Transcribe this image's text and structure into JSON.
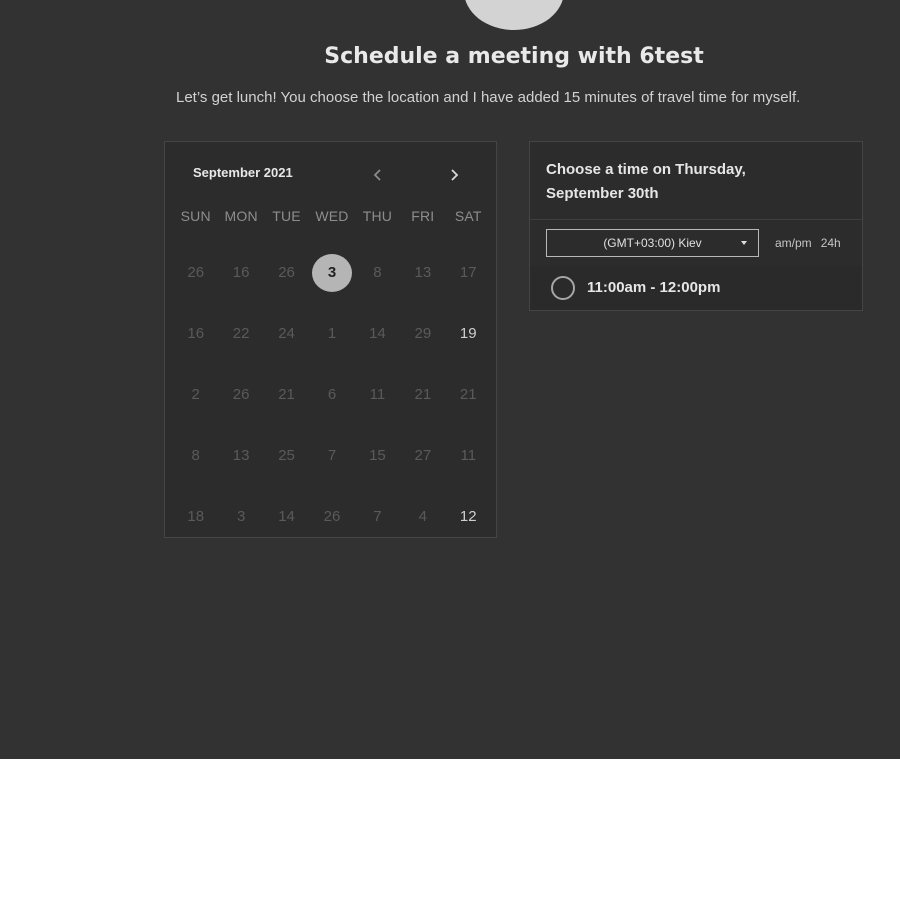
{
  "page": {
    "title": "Schedule a meeting with 6test",
    "description": "Let’s get lunch! You choose the location and I have added 15 minutes of travel time for myself."
  },
  "calendar": {
    "month_label": "September 2021",
    "prev_icon": "chevron-left-icon",
    "next_icon": "chevron-right-icon",
    "weekdays": [
      "SUN",
      "MON",
      "TUE",
      "WED",
      "THU",
      "FRI",
      "SAT"
    ],
    "days": [
      {
        "label": "26",
        "state": "disabled"
      },
      {
        "label": "16",
        "state": "disabled"
      },
      {
        "label": "26",
        "state": "available"
      },
      {
        "label": "3",
        "state": "selected"
      },
      {
        "label": "8",
        "state": "disabled"
      },
      {
        "label": "13",
        "state": "disabled"
      },
      {
        "label": "17",
        "state": "disabled"
      },
      {
        "label": "16",
        "state": "disabled"
      },
      {
        "label": "22",
        "state": "disabled"
      },
      {
        "label": "24",
        "state": "disabled"
      },
      {
        "label": "1",
        "state": "disabled"
      },
      {
        "label": "14",
        "state": "disabled"
      },
      {
        "label": "29",
        "state": "disabled"
      },
      {
        "label": "19",
        "state": "bright"
      },
      {
        "label": "2",
        "state": "disabled"
      },
      {
        "label": "26",
        "state": "disabled"
      },
      {
        "label": "21",
        "state": "disabled"
      },
      {
        "label": "6",
        "state": "available"
      },
      {
        "label": "11",
        "state": "disabled"
      },
      {
        "label": "21",
        "state": "disabled"
      },
      {
        "label": "21",
        "state": "disabled"
      },
      {
        "label": "8",
        "state": "disabled"
      },
      {
        "label": "13",
        "state": "disabled"
      },
      {
        "label": "25",
        "state": "available"
      },
      {
        "label": "7",
        "state": "available"
      },
      {
        "label": "15",
        "state": "disabled"
      },
      {
        "label": "27",
        "state": "disabled"
      },
      {
        "label": "11",
        "state": "disabled"
      },
      {
        "label": "18",
        "state": "disabled"
      },
      {
        "label": "3",
        "state": "available"
      },
      {
        "label": "14",
        "state": "disabled"
      },
      {
        "label": "26",
        "state": "disabled"
      },
      {
        "label": "7",
        "state": "disabled"
      },
      {
        "label": "4",
        "state": "disabled"
      },
      {
        "label": "12",
        "state": "bright"
      }
    ]
  },
  "times": {
    "header": "Choose a time on Thursday, September 30th",
    "timezone": "(GMT+03:00) Kiev",
    "format_12h": "am/pm",
    "format_24h": "24h",
    "slots": [
      {
        "label": "11:00am - 12:00pm",
        "selected": false
      }
    ]
  },
  "colors": {
    "background": "#323232",
    "panel": "#2c2c2c",
    "selected_day": "#b5b5b5"
  }
}
